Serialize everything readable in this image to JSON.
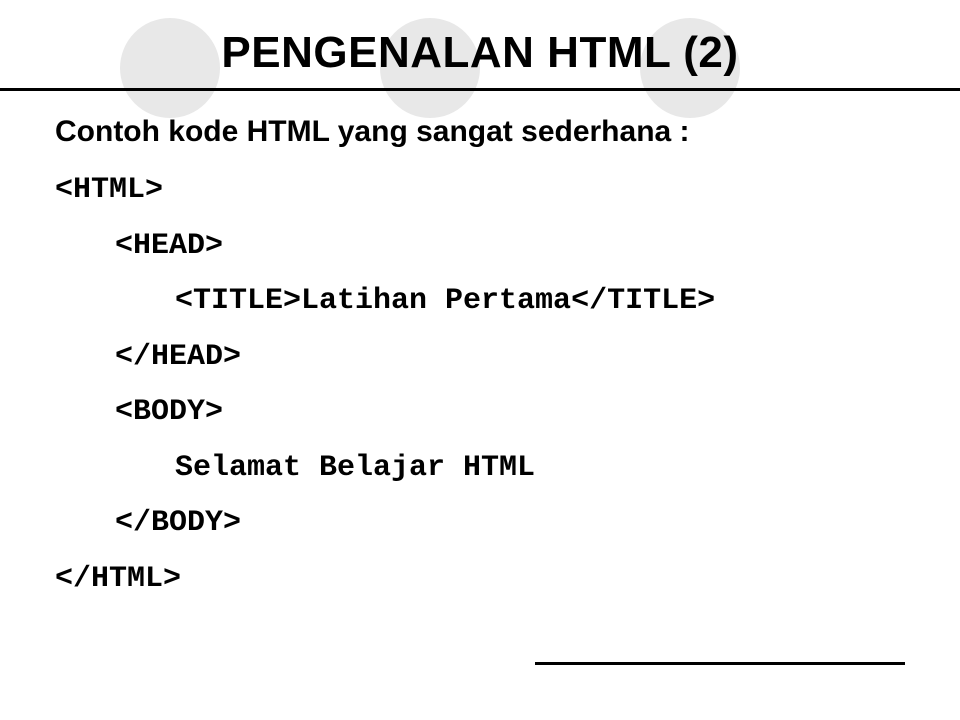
{
  "slide": {
    "title": "PENGENALAN HTML (2)",
    "intro": "Contoh kode HTML yang sangat sederhana :",
    "code": {
      "line1": "<HTML>",
      "line2": "<HEAD>",
      "line3": "<TITLE>Latihan Pertama</TITLE>",
      "line4": "</HEAD>",
      "line5": "<BODY>",
      "line6": "Selamat Belajar HTML",
      "line7": "</BODY>",
      "line8": "</HTML>"
    }
  }
}
